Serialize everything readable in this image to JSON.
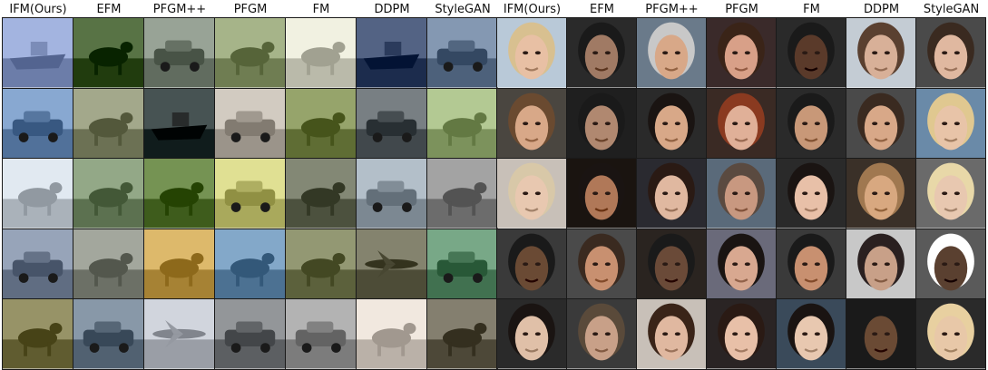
{
  "figure": {
    "panels": [
      {
        "id": "cifar",
        "columns": [
          "IFM(Ours)",
          "EFM",
          "PFGM++",
          "PFGM",
          "FM",
          "DDPM",
          "StyleGAN"
        ],
        "rows": 5,
        "tiles": [
          [
            "boat",
            "frog",
            "car",
            "deer",
            "horse",
            "ship",
            "truck"
          ],
          [
            "car",
            "bird",
            "ship",
            "car",
            "deer",
            "truck",
            "dog"
          ],
          [
            "horse",
            "dog",
            "frog",
            "truck",
            "horse",
            "car",
            "cat"
          ],
          [
            "truck",
            "cat",
            "deer",
            "horse",
            "frog",
            "airplane",
            "car"
          ],
          [
            "deer",
            "truck",
            "airplane",
            "car",
            "truck",
            "frog",
            "cat"
          ]
        ]
      },
      {
        "id": "celeba",
        "columns": [
          "IFM(Ours)",
          "EFM",
          "PFGM++",
          "PFGM",
          "FM",
          "DDPM",
          "StyleGAN"
        ],
        "rows": 5,
        "tiles": [
          [
            "face",
            "face",
            "face",
            "face",
            "face",
            "face",
            "face"
          ],
          [
            "face",
            "face",
            "face",
            "face",
            "face",
            "face",
            "face"
          ],
          [
            "face",
            "face",
            "face",
            "face",
            "face",
            "face",
            "face"
          ],
          [
            "face",
            "face",
            "face",
            "face",
            "face",
            "face",
            "face"
          ],
          [
            "face",
            "face",
            "face",
            "face",
            "face",
            "face",
            "face"
          ]
        ]
      }
    ],
    "palettes": {
      "cifar": [
        [
          "#8a9bc7",
          "#3f5a2c",
          "#7f8a7d",
          "#8d9b70",
          "#d8d8c8",
          "#3a4a6b",
          "#6b7f99"
        ],
        [
          "#6f8fb8",
          "#8a8f72",
          "#2e3a3a",
          "#b9b2a8",
          "#7d8b52",
          "#5f666a",
          "#9ab07a"
        ],
        [
          "#c8d0d8",
          "#7a8f6e",
          "#5c7a3a",
          "#c7c77a",
          "#6a6f5c",
          "#9aa6b0",
          "#8a8a8a"
        ],
        [
          "#7e8ba0",
          "#8a8e84",
          "#c4a052",
          "#6a8fb0",
          "#7a7f5a",
          "#6b6a55",
          "#5f8f6e"
        ],
        [
          "#7e7a4e",
          "#6f7f8f",
          "#b8bcc4",
          "#7a7d80",
          "#9a9a9a",
          "#d8cfc6",
          "#6b6656"
        ]
      ],
      "celeba_bg": [
        [
          "#b9c9d8",
          "#2a2a2a",
          "#6a7a8a",
          "#3a2a2a",
          "#2a2a2a",
          "#c4ccd4",
          "#4a4a4a"
        ],
        [
          "#4a4640",
          "#1f1f1f",
          "#2a2a2a",
          "#3a2a24",
          "#2a2a2a",
          "#4a4a4a",
          "#6a8aa8"
        ],
        [
          "#c8c0b8",
          "#1a1410",
          "#2a2a30",
          "#5a6a7a",
          "#2a2a2a",
          "#3a3028",
          "#6a6a6a"
        ],
        [
          "#3a3a3a",
          "#4a4a4a",
          "#2a2420",
          "#6a6a7a",
          "#3a3a3a",
          "#c8c8c8",
          "#5a5a5a"
        ],
        [
          "#2a2a2a",
          "#3a3a3a",
          "#c8c0b8",
          "#2a2424",
          "#3a4a5a",
          "#1a1a1a",
          "#2a2a2a"
        ]
      ],
      "celeba_skin": [
        [
          "#e8c0a4",
          "#a07a64",
          "#d8a888",
          "#d8a088",
          "#5a3a2a",
          "#d8b098",
          "#e0b8a0"
        ],
        [
          "#d8a888",
          "#b08870",
          "#d8a888",
          "#e0b098",
          "#c89878",
          "#d8a888",
          "#e8c4a8"
        ],
        [
          "#e8c8b0",
          "#b07858",
          "#e0b8a0",
          "#c89880",
          "#e8c0a8",
          "#d8a880",
          "#e8c8b0"
        ],
        [
          "#6a4a34",
          "#c89070",
          "#6a4a38",
          "#d8a890",
          "#c89070",
          "#c8a088",
          "#5a4030"
        ],
        [
          "#e0c0a8",
          "#c8a088",
          "#e0b8a0",
          "#e8c0a8",
          "#e8c8b0",
          "#6a4a34",
          "#e8c8a8"
        ]
      ],
      "celeba_hair": [
        [
          "#d8c090",
          "#1a1a1a",
          "#c8c8c8",
          "#3a2418",
          "#1a1a1a",
          "#5a4030",
          "#3a2a20"
        ],
        [
          "#6a4a30",
          "#1a1a1a",
          "#1a1412",
          "#8a3a20",
          "#1a1a1a",
          "#3a2a20",
          "#e0c890"
        ],
        [
          "#d8c8a8",
          "#1a1412",
          "#2a1a14",
          "#5a4a40",
          "#1a1412",
          "#a07850",
          "#e8d8a8"
        ],
        [
          "#1a1a1a",
          "#3a2a20",
          "#1a1a1a",
          "#1a1412",
          "#1a1a1a",
          "#2a2020",
          "#ffffff"
        ],
        [
          "#1a1412",
          "#5a4a3a",
          "#3a2418",
          "#2a1a14",
          "#1a1412",
          "#1a1a1a",
          "#e8d0a0"
        ]
      ]
    }
  }
}
